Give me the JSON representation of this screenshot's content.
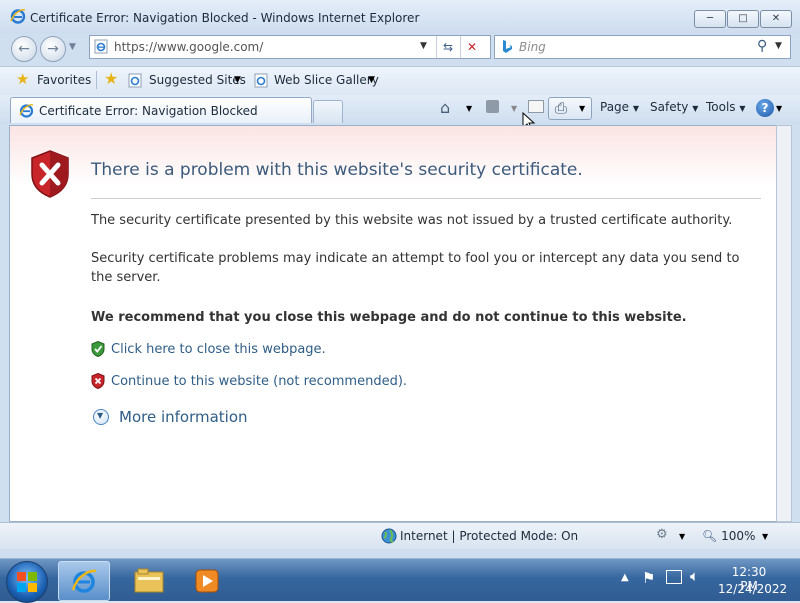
{
  "window": {
    "title": "Certificate Error: Navigation Blocked - Windows Internet Explorer",
    "minimize_icon": "minimize-icon",
    "maximize_icon": "maximize-icon",
    "close_icon": "close-icon"
  },
  "nav": {
    "address": "https://www.google.com/",
    "search_placeholder": "Bing"
  },
  "favorites_bar": {
    "favorites_label": "Favorites",
    "suggested_label": "Suggested Sites",
    "webslice_label": "Web Slice Gallery"
  },
  "tabs": {
    "active_label": "Certificate Error: Navigation Blocked"
  },
  "command_bar": {
    "page_label": "Page",
    "safety_label": "Safety",
    "tools_label": "Tools"
  },
  "page": {
    "heading": "There is a problem with this website's security certificate.",
    "para1": "The security certificate presented by this website was not issued by a trusted certificate authority.",
    "para2": "Security certificate problems may indicate an attempt to fool you or intercept any data you send to the server.",
    "recommend": "We recommend that you close this webpage and do not continue to this website.",
    "close_link": "Click here to close this webpage.",
    "continue_link": "Continue to this website (not recommended).",
    "more_info": "More information"
  },
  "status_bar": {
    "zone": "Internet | Protected Mode: On",
    "zoom": "100%"
  },
  "taskbar": {
    "time": "12:30 PM",
    "date": "12/24/2022"
  },
  "colors": {
    "accent": "#2f5d87",
    "heading": "#3b5a7c",
    "danger": "#c8252b",
    "safe": "#3c9a3c"
  }
}
